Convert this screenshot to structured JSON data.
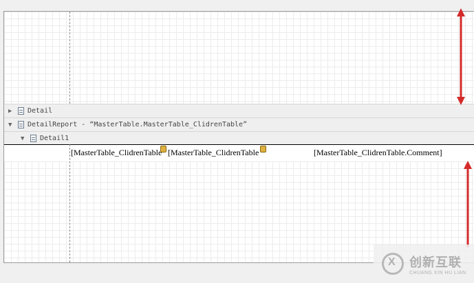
{
  "bands": {
    "detail": {
      "label": "Detail",
      "toggle": "▶"
    },
    "detail_report": {
      "label": "DetailReport - “MasterTable.MasterTable_ClidrenTable”",
      "toggle": "▼"
    },
    "detail1": {
      "label": "Detail1",
      "toggle": "▼"
    }
  },
  "fields": [
    {
      "text": "[MasterTable_ClidrenTable"
    },
    {
      "text": "[MasterTable_ClidrenTable"
    },
    {
      "text": "[MasterTable_ClidrenTable.Comment]"
    }
  ],
  "annotations": {
    "arrow_color": "#d42a2a"
  },
  "watermark": {
    "cn": "创新互联",
    "en": "CHUANG XIN HU LIAN"
  }
}
